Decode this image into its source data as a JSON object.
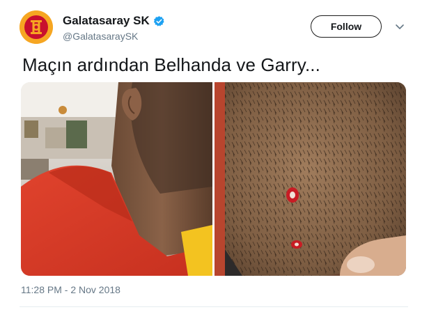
{
  "account": {
    "display_name": "Galatasaray SK",
    "handle": "@GalatasaraySK",
    "verified": true,
    "avatar_icon": "galatasaray-crest-icon"
  },
  "actions": {
    "follow_label": "Follow",
    "more_icon": "chevron-down-icon"
  },
  "tweet": {
    "text": "Maçın ardından Belhanda ve Garry...",
    "timestamp": "11:28 PM - 2 Nov 2018"
  },
  "media": {
    "images": [
      "neck-injury-photo",
      "leg-injury-photo"
    ]
  },
  "colors": {
    "verified": "#1da1f2",
    "muted_text": "#657786",
    "crest_red": "#c8102e",
    "crest_yellow": "#f6a622"
  }
}
